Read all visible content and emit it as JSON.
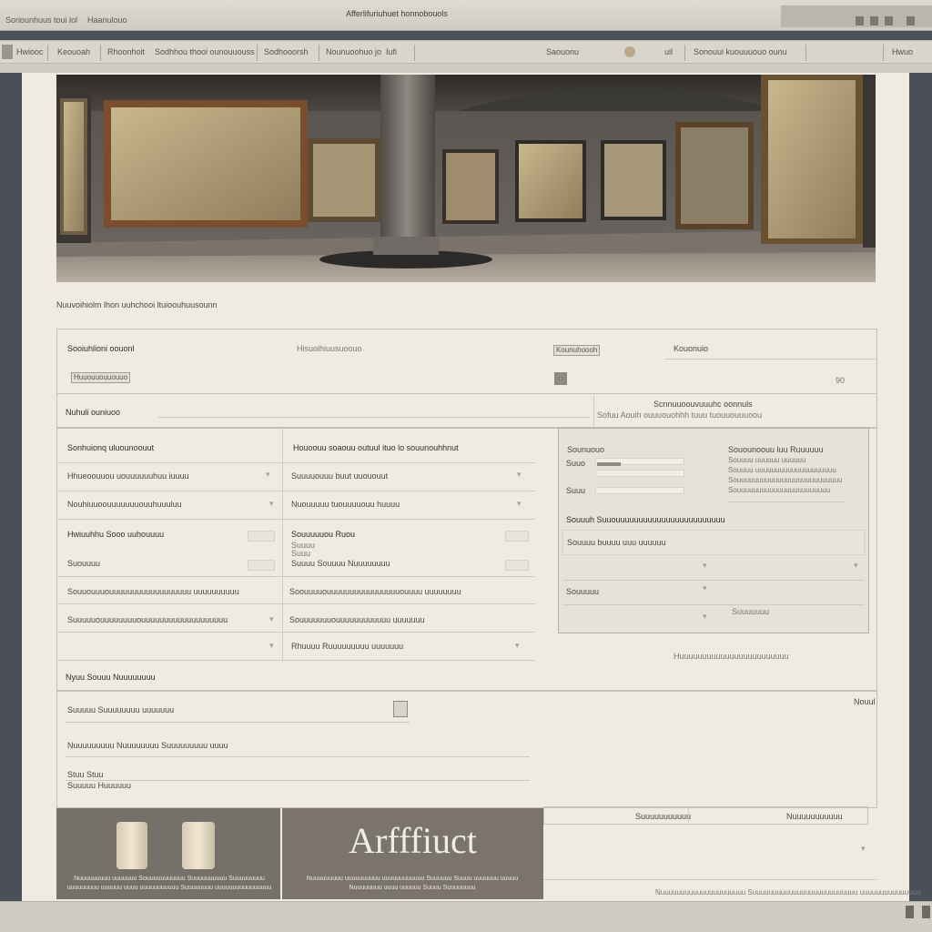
{
  "window": {
    "title": "Afferlifuriuhuet honnobouols",
    "menu_left": "Soriounhuus toui lol",
    "menu_right": "Haanulouo"
  },
  "toolbar": {
    "items": [
      "Hwiooc",
      "Keouoah",
      "Rhoonhoit",
      "Sodhhou thooi ounouuouss",
      "Sodhooorsh",
      "Nounuoohuo jo",
      "Iufi",
      "Saouonu",
      "uil",
      "Sonouui kuouuuouo ounu",
      "Hwuo"
    ]
  },
  "gallery": {
    "caption": "Nuuvoihiolm lhon uuhchooi ltuioouhuusounn"
  },
  "search": {
    "title": "Sooiuhlioni oouonl",
    "field_label": "Hisuoihiuusuoouo",
    "button": "Kounuhoooh",
    "filter_label": "Kouonuio",
    "tag": "Huuouuouuouuo",
    "count": "90"
  },
  "collection": {
    "title": "Nuhuli ouniuoo",
    "info_heading": "Scnnuuoouvuuuhc oonnuls",
    "info_text": "Sofuu Aouih ouuuouohhh tuuu tuouuouuuoou"
  },
  "list": {
    "col_left": "Sonhuionq uluounoouut",
    "col_right": "Houoouu soaouu outuul ituo lo souunouhhnut",
    "rows": [
      {
        "left": "Hhueoouuou uouuuuuuhuu iuuuu",
        "right": "Suuuuouuu buut uuououut"
      },
      {
        "left": "Nouhiuuoouuuuuuuouuhuuuluu",
        "right": "Nuouuuuu tuouuuuouu huuuu"
      },
      {
        "left": "Hwiuuhhu Sooo uuhouuuu",
        "right": "Souuuuuou Ruou"
      },
      {
        "left": "Suouuuu",
        "right": "Suuuu Souuuu Nuuuuuuuu"
      },
      {
        "left": "Souuouuuouuuuuuuuuuuuuuuuuu uuuuuuuuuu",
        "right": "Soouuuuouuuuuuuuuuuuuuuuouuuu uuuuuuuu"
      },
      {
        "left": "Suuuuuouuuuuuuuouuuuuuuuuuuuuuuuuuu",
        "right": "Souuuuuuuouuuuuuuuuuuu uuuuuuu"
      },
      {
        "left": "",
        "right": "Rhuuuu Ruuuuuuuuu uuuuuuu"
      }
    ]
  },
  "detail": {
    "label_a": "Sounuouo",
    "label_b": "Suuo",
    "label_c": "Suuu",
    "notes_heading": "Souounoouu luu Ruuuuuu",
    "notes_lines": [
      "Souuuu uuuuuu uuuuuu",
      "Souuuu uuuuuuuuuuuuuuuuuuuu",
      "Souuuuuuuuuuuuuuuuuuuuuuuuuu",
      "Souuuuuuuuuuuuuuuuuuuuuuu"
    ],
    "section": "Souuuh Suuouuuuuuuuuuuuuuuuuuuuuuuu",
    "field_1": "Souuuu buuuu uuu uuuuuu",
    "field_2": "Souuuuu",
    "small_btn": "Suuuuuuu",
    "under": "Huuuuuuuuuuuuuuuuuuuuuuuu"
  },
  "lower": {
    "title": "Nyuu Souuu Nuuuuuuuu",
    "field": "Suuuuu Suuuuuuuu uuuuuuu",
    "corner": "Nouul",
    "desc": "Nuuuuuuuuu Nuuuuuuuu Suuuuuuuuu uuuu",
    "meta_1": "Stuu Stuu",
    "meta_2": "Suuuuu  Huuuuuu"
  },
  "cards": {
    "left_caption": "Nuuuuuuuuu uuuuuuu Souuuuuuuuuuu Suuuuuuuuuu Suuuuuuuuu uuuuuuuuu uuuuuu uuuu uuuuuuuuuuu Suuuuuuuu uuuuuuuuuuuuuuuu",
    "brand": "Arfffiuct",
    "right_caption": "Nuuuuuuuuu uuuuuuuuuu uuuuuuuuuuuu Suuuuuu Suuuu uuuuuuu uuuuu Nuuuuuuuu uuuu uuuuuu Suuuu Suuuuuuuu",
    "tab_left": "Suuuuuuuuuuu",
    "tab_right": "Nuuuuuuuuuuu",
    "bottom_text": "Nuuuuuuuuuuuuuuuuuuuuu Suuuuuuuuuuuuuuuuuuuuuuuuuu uuuuuuuuuuuuuuu"
  },
  "colors": {
    "accent": "#7a746d",
    "page": "#eeebe2",
    "frame": "#4b4f5a"
  }
}
